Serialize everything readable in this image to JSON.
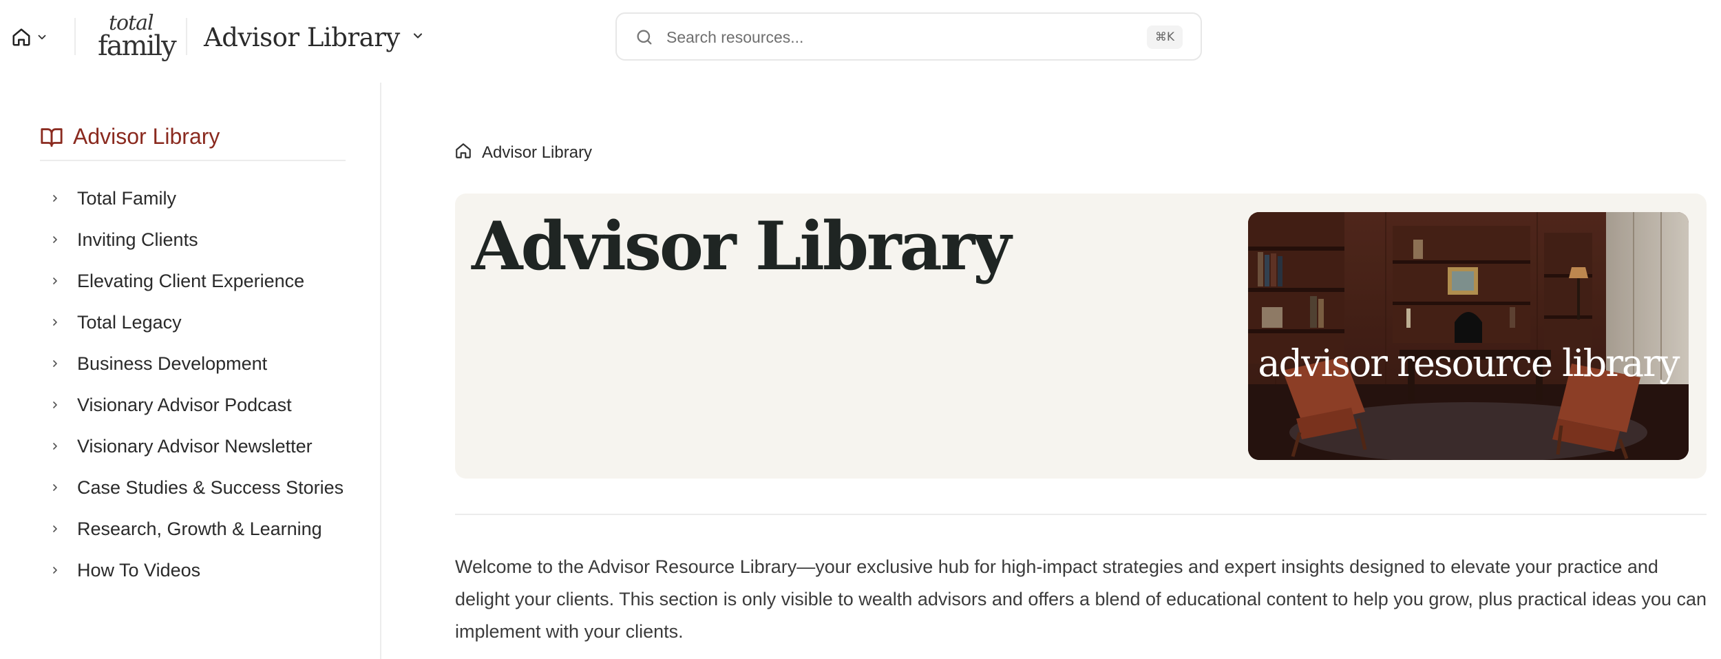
{
  "header": {
    "app_title": "Advisor Library",
    "logo": {
      "line1": "total",
      "line2": "family"
    },
    "search": {
      "placeholder": "Search resources...",
      "shortcut": "⌘K"
    }
  },
  "sidebar": {
    "title": "Advisor Library",
    "items": [
      {
        "label": "Total Family"
      },
      {
        "label": "Inviting Clients"
      },
      {
        "label": "Elevating Client Experience"
      },
      {
        "label": "Total Legacy"
      },
      {
        "label": "Business Development"
      },
      {
        "label": "Visionary Advisor Podcast"
      },
      {
        "label": "Visionary Advisor Newsletter"
      },
      {
        "label": "Case Studies & Success Stories"
      },
      {
        "label": "Research, Growth & Learning"
      },
      {
        "label": "How To Videos"
      }
    ]
  },
  "main": {
    "breadcrumb": "Advisor Library",
    "hero_title": "Advisor Library",
    "hero_image_caption": "advisor resource library",
    "intro": "Welcome to the Advisor Resource Library—your exclusive hub for high-impact strategies and expert insights designed to elevate your practice and delight your clients. This section is only visible to wealth advisors and offers a blend of educational content to help you grow, plus practical ideas you can implement with your clients."
  },
  "colors": {
    "accent": "#8a2a1f",
    "hero_background": "#f6f4ef",
    "text": "#2a2a2a",
    "border": "#ececec"
  },
  "icons": {
    "home": "home-icon",
    "dropdown": "chevron-down-icon",
    "search": "search-icon",
    "sidebar_header": "book-open-icon",
    "sidebar_item": "chevron-right-icon"
  }
}
